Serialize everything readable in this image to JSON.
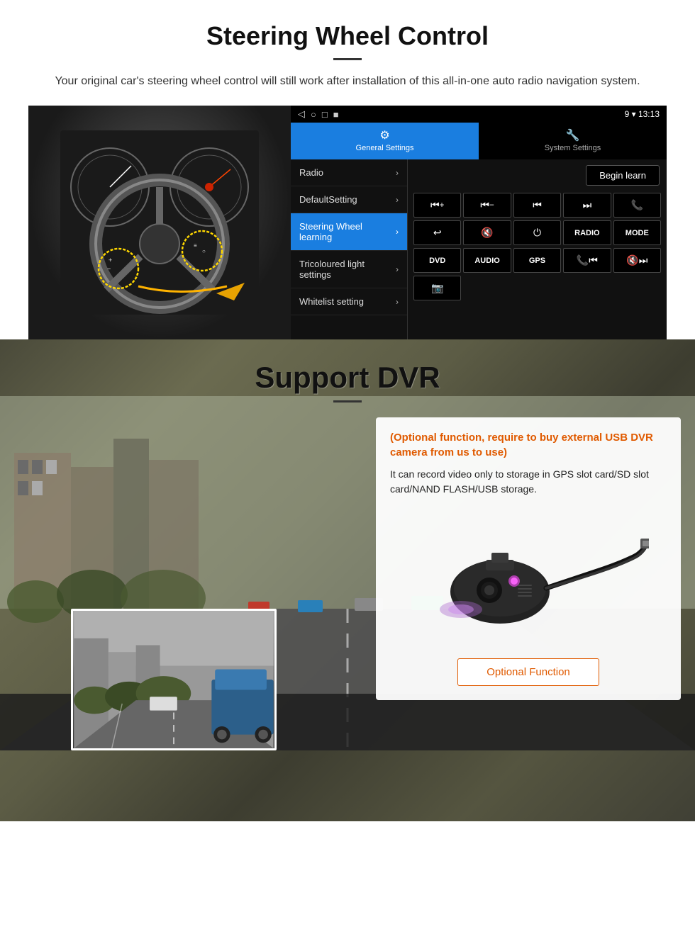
{
  "steering": {
    "title": "Steering Wheel Control",
    "subtitle": "Your original car's steering wheel control will still work after installation of this all-in-one auto radio navigation system.",
    "statusbar": {
      "icons": [
        "◁",
        "○",
        "□",
        "■"
      ],
      "right": "9 ▾ 13:13"
    },
    "tabs": [
      {
        "icon": "⚙",
        "label": "General Settings",
        "active": true
      },
      {
        "icon": "🔧",
        "label": "System Settings",
        "active": false
      }
    ],
    "menu": [
      {
        "label": "Radio",
        "active": false
      },
      {
        "label": "DefaultSetting",
        "active": false
      },
      {
        "label": "Steering Wheel learning",
        "active": true
      },
      {
        "label": "Tricoloured light settings",
        "active": false
      },
      {
        "label": "Whitelist setting",
        "active": false
      }
    ],
    "begin_learn": "Begin learn",
    "controls_row1": [
      "⏮+",
      "⏮−",
      "⏮⏮",
      "⏭⏭",
      "📞"
    ],
    "controls_row2": [
      "↩",
      "🔇",
      "⏻",
      "RADIO",
      "MODE"
    ],
    "controls_row3": [
      "DVD",
      "AUDIO",
      "GPS",
      "📞⏮",
      "🔇⏭"
    ],
    "controls_row4": [
      "📷"
    ]
  },
  "dvr": {
    "title": "Support DVR",
    "optional_text": "(Optional function, require to buy external USB DVR camera from us to use)",
    "description": "It can record video only to storage in GPS slot card/SD slot card/NAND FLASH/USB storage.",
    "optional_function_btn": "Optional Function"
  }
}
